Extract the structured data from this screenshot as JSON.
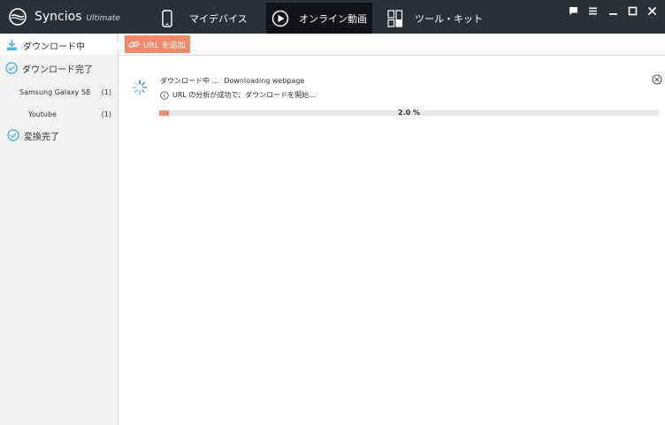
{
  "app": {
    "name": "Syncios",
    "edition": "Ultimate"
  },
  "nav": {
    "tabs": [
      {
        "label": "マイデバイス",
        "icon": "phone-icon"
      },
      {
        "label": "オンライン動画",
        "icon": "play-icon",
        "active": true
      },
      {
        "label": "ツール・キット",
        "icon": "toolkit-icon"
      }
    ]
  },
  "window_controls": [
    "chat-icon",
    "menu-icon",
    "minimize-icon",
    "maximize-icon",
    "close-icon"
  ],
  "sidebar": {
    "items": [
      {
        "label": "ダウンロード中",
        "icon": "download-icon",
        "active": true
      },
      {
        "label": "ダウンロード完了",
        "icon": "check-circle-icon"
      },
      {
        "label": "変換完了",
        "icon": "check-circle-icon"
      }
    ],
    "sub_items": [
      {
        "label": "Samsung Galaxy S8",
        "count": "(1)"
      },
      {
        "label": "Youtube",
        "count": "(1)"
      }
    ]
  },
  "toolbar": {
    "add_url_label": "URL を追加"
  },
  "task": {
    "title_jp": "ダウンロード中 ...",
    "title_en": "Downloading webpage",
    "status": "URL の分析が成功で、ダウンロードを開始...",
    "progress_label": "2.0 %",
    "progress_fraction": 0.02
  },
  "colors": {
    "accent": "#f4886b",
    "titlebar": "#2b2f36",
    "active_tab": "#111317",
    "icon_blue": "#4bb6e6"
  }
}
